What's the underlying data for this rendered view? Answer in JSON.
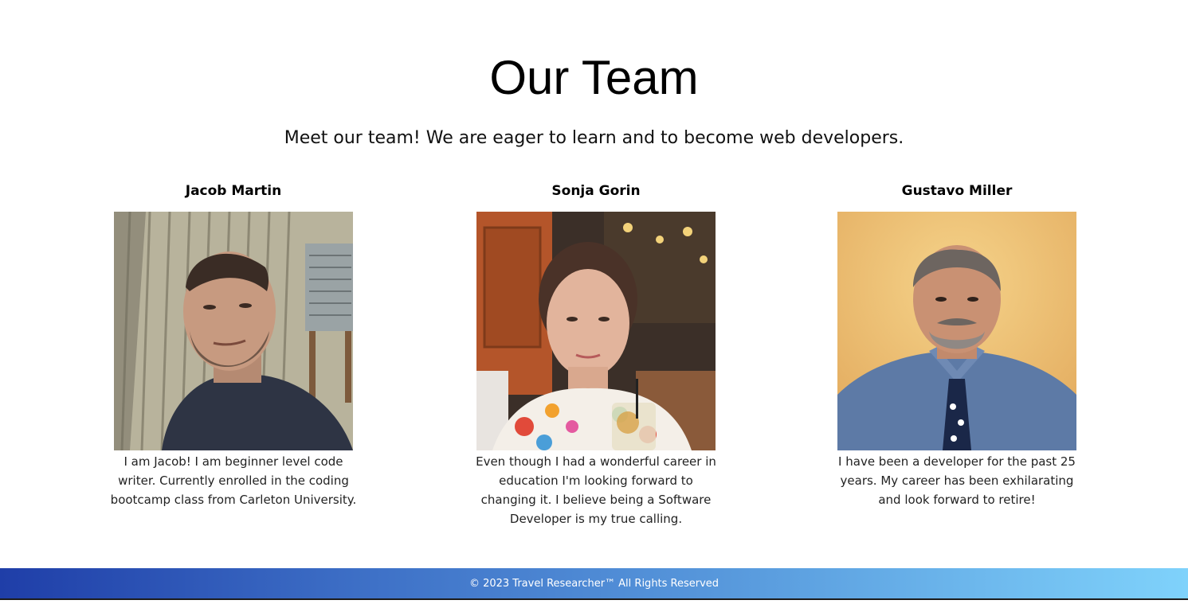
{
  "page": {
    "title": "Our Team",
    "subtitle": "Meet our team! We are eager to learn and to become web developers."
  },
  "team": [
    {
      "name": "Jacob Martin",
      "bio": "I am Jacob! I am beginner level code writer. Currently enrolled in the coding bootcamp class from Carleton University."
    },
    {
      "name": "Sonja Gorin",
      "bio": "Even though I had a wonderful career in education I'm looking forward to changing it. I believe being a Software Developer is my true calling."
    },
    {
      "name": "Gustavo Miller",
      "bio": "I have been a developer for the past 25 years. My career has been exhilarating and look forward to retire!"
    }
  ],
  "footer": {
    "text": "© 2023 Travel Researcher™ All Rights Reserved"
  },
  "colors": {
    "footer_gradient_start": "#1f3ea8",
    "footer_gradient_end": "#7fd2fb"
  }
}
